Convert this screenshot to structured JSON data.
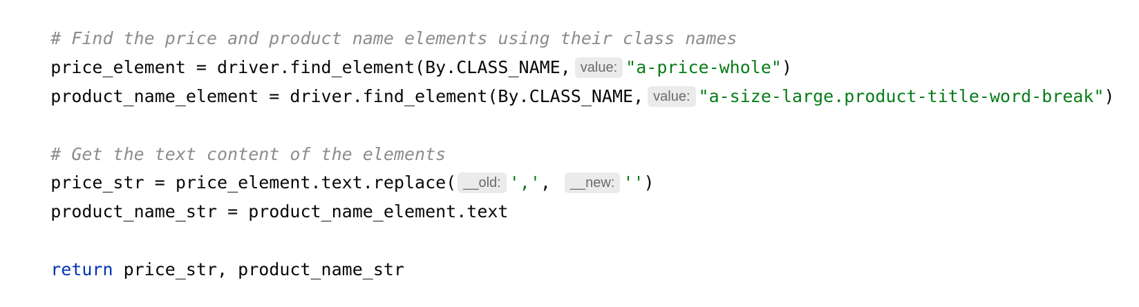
{
  "code": {
    "comment1": "# Find the price and product name elements using their class names",
    "l2_prefix": "price_element = driver.find_element(By.CLASS_NAME,",
    "l2_hint": "value:",
    "l2_string": "\"a-price-whole\"",
    "l2_suffix": ")",
    "l3_prefix": "product_name_element = driver.find_element(By.CLASS_NAME,",
    "l3_hint": "value:",
    "l3_string": "\"a-size-large.product-title-word-break\"",
    "l3_suffix": ")",
    "comment2": "# Get the text content of the elements",
    "l6_prefix": "price_str = price_element.text.replace(",
    "l6_hint1": "__old:",
    "l6_string1": "','",
    "l6_comma": ",",
    "l6_hint2": "__new:",
    "l6_string2": "''",
    "l6_suffix": ")",
    "l7_text": "product_name_str = product_name_element.text",
    "l9_keyword": "return",
    "l9_rest": " price_str, product_name_str"
  },
  "colors": {
    "comment": "#8c8c8c",
    "string": "#067d17",
    "keyword": "#0033b3",
    "text": "#080808",
    "hint_bg": "#ebebeb"
  }
}
